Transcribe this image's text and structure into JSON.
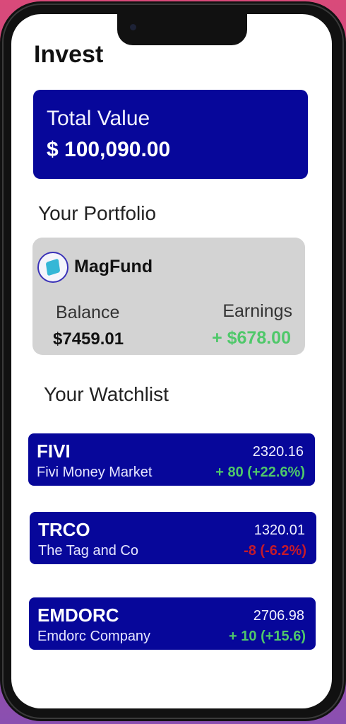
{
  "header": {
    "title": "Invest"
  },
  "total": {
    "label": "Total Value",
    "value": "$ 100,090.00"
  },
  "portfolio": {
    "section_title": "Your Portfolio",
    "fund_name": "MagFund",
    "balance_label": "Balance",
    "balance_value": "$7459.01",
    "earnings_label": "Earnings",
    "earnings_value": "+ $678.00"
  },
  "watchlist": {
    "section_title": "Your Watchlist",
    "items": [
      {
        "ticker": "FIVI",
        "name": "Fivi Money Market",
        "price": "2320.16",
        "change": "+ 80 (+22.6%)",
        "trend": "up"
      },
      {
        "ticker": "TRCO",
        "name": "The Tag and Co",
        "price": "1320.01",
        "change": "-8 (-6.2%)",
        "trend": "down"
      },
      {
        "ticker": "EMDORC",
        "name": "Emdorc Company",
        "price": "2706.98",
        "change": "+ 10 (+15.6)",
        "trend": "up"
      }
    ]
  },
  "colors": {
    "card_blue": "#07079a",
    "positive": "#4fc86a",
    "negative": "#c51a2a",
    "portfolio_bg": "#d3d3d3"
  },
  "icons": {
    "fund_logo": "magfund-logo-icon",
    "camera": "front-camera-icon"
  }
}
